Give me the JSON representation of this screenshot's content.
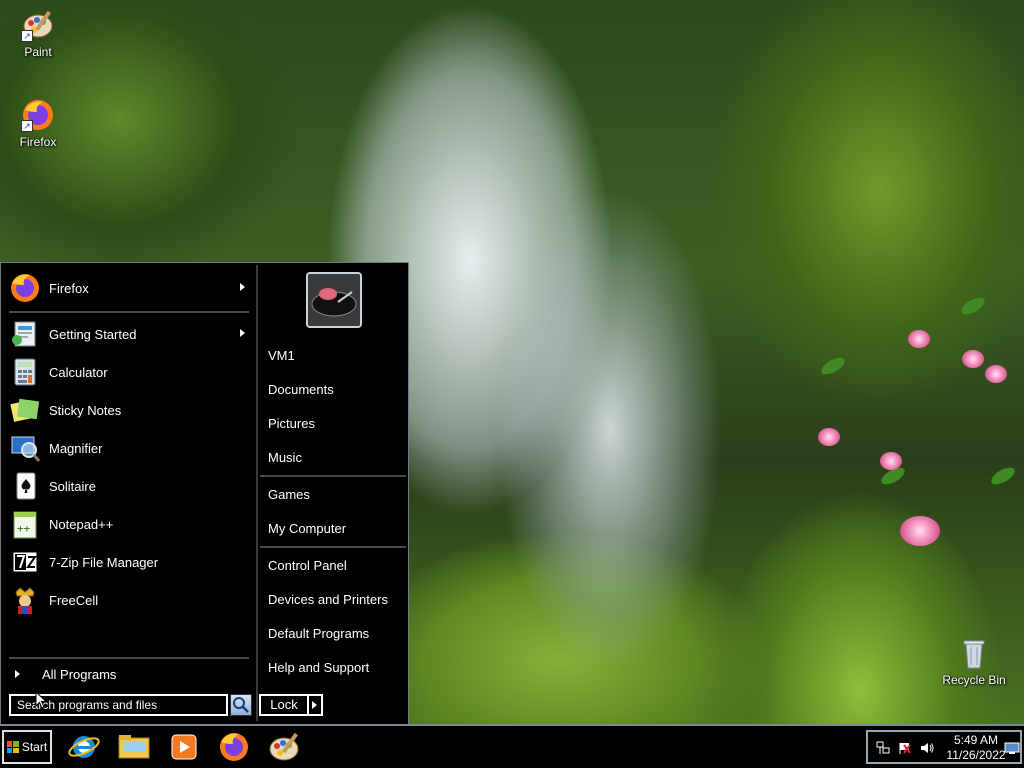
{
  "desktop": {
    "icons": [
      {
        "label": "Paint",
        "icon": "paint-icon"
      },
      {
        "label": "Firefox",
        "icon": "firefox-icon"
      },
      {
        "label": "Recycle Bin",
        "icon": "recycle-bin-icon"
      }
    ]
  },
  "start_menu": {
    "pinned_programs": [
      {
        "label": "Firefox",
        "icon": "firefox-icon",
        "has_submenu": true
      }
    ],
    "recent_programs": [
      {
        "label": "Getting Started",
        "icon": "getting-started-icon",
        "has_submenu": true
      },
      {
        "label": "Calculator",
        "icon": "calculator-icon",
        "has_submenu": false
      },
      {
        "label": "Sticky Notes",
        "icon": "sticky-notes-icon",
        "has_submenu": false
      },
      {
        "label": "Magnifier",
        "icon": "magnifier-icon",
        "has_submenu": false
      },
      {
        "label": "Solitaire",
        "icon": "solitaire-icon",
        "has_submenu": false
      },
      {
        "label": "Notepad++",
        "icon": "notepad-plus-plus-icon",
        "has_submenu": false
      },
      {
        "label": "7-Zip File Manager",
        "icon": "seven-zip-icon",
        "has_submenu": false
      },
      {
        "label": "FreeCell",
        "icon": "freecell-icon",
        "has_submenu": false
      }
    ],
    "all_programs_label": "All Programs",
    "search": {
      "placeholder": "Search programs and files",
      "value": ""
    },
    "right_items": {
      "user": "VM1",
      "documents": "Documents",
      "pictures": "Pictures",
      "music": "Music",
      "games": "Games",
      "computer": "My Computer",
      "control_panel": "Control Panel",
      "devices": "Devices and Printers",
      "default_programs": "Default Programs",
      "help": "Help and Support"
    },
    "lock_label": "Lock"
  },
  "taskbar": {
    "start_label": "Start",
    "pinned": [
      {
        "icon": "internet-explorer-icon"
      },
      {
        "icon": "file-explorer-icon"
      },
      {
        "icon": "media-player-icon"
      },
      {
        "icon": "firefox-icon"
      },
      {
        "icon": "paint-icon"
      }
    ],
    "tray": {
      "icons": [
        "network-icon",
        "action-center-flag-icon",
        "volume-icon",
        "show-desktop-icon"
      ],
      "time": "5:49 AM",
      "date": "11/26/2022"
    }
  },
  "colors": {
    "menu_background": "#000000",
    "menu_text": "#ffffff",
    "taskbar_background": "#000000",
    "border": "#7a8a94"
  }
}
